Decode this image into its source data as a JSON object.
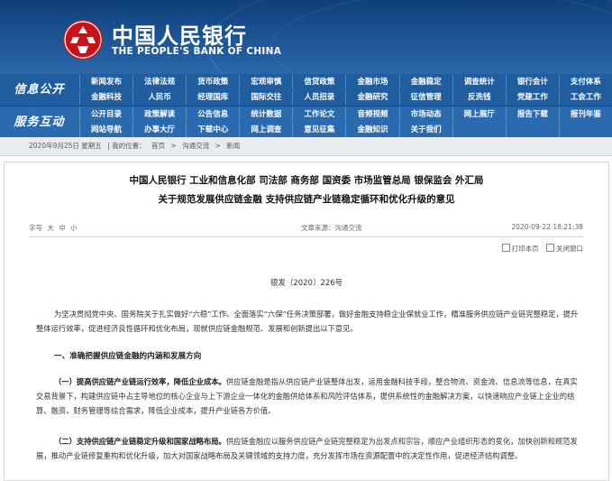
{
  "header": {
    "brand_cn": "中国人民银行",
    "brand_en": "THE PEOPLE'S BANK OF CHINA"
  },
  "nav": {
    "section1_label": "信息公开",
    "section1_items": [
      "新闻发布",
      "法律法规",
      "货币政策",
      "宏观审慎",
      "信贷政策",
      "金融市场",
      "金融稳定",
      "调查统计",
      "银行会计",
      "支付体系",
      "金融科技",
      "人民币",
      "经理国库",
      "国际交往",
      "人员招录",
      "金融研究",
      "征信管理",
      "反洗钱",
      "党建工作",
      "工会工作"
    ],
    "section2_label": "服务互动",
    "section2_items": [
      "公开目录",
      "政策解读",
      "公告信息",
      "统计数据",
      "工作论文",
      "音频视频",
      "市场动态",
      "网上展厅",
      "报告下载",
      "报刊年鉴",
      "网站导航",
      "办事大厅",
      "下载中心",
      "网上调查",
      "意见征集",
      "金融知识",
      "关于我们",
      "",
      "",
      ""
    ]
  },
  "breadcrumb": {
    "date": "2020年9月25日 星期五",
    "prefix": "| 我的位置：",
    "items": [
      "首页",
      "沟通交流",
      "新闻"
    ],
    "sep": ">"
  },
  "article": {
    "orgs": "中国人民银行  工业和信息化部  司法部  商务部  国资委  市场监管总局  银保监会  外汇局",
    "title": "关于规范发展供应链金融  支持供应链产业链稳定循环和优化升级的意见",
    "size_label": "字号",
    "size_options": [
      "大",
      "中",
      "小"
    ],
    "source": "文章来源：沟通交流",
    "date": "2020-09-22  18:21:38",
    "print_label": "打印本页",
    "close_label": "关闭窗口",
    "doc_number": "银发〔2020〕226号",
    "p1": "为坚决贯彻党中央、国务院关于扎实做好“六稳”工作、全面落实“六保”任务决策部署，做好金融支持稳企业保就业工作，精准服务供应链产业链完整稳定，提升整体运行效率，促进经济良性循环和优化布局，现就供应链金融规范、发展和创新提出以下意见。",
    "h1": "一、准确把握供应链金融的内涵和发展方向",
    "p2_lead": "（一）提高供应链产业链运行效率，降低企业成本。",
    "p2": "供应链金融是指从供应链产业链整体出发，运用金融科技手段，整合物流、资金流、信息流等信息，在真实交易背景下，构建供应链中占主导地位的核心企业与上下游企业一体化的金融供给体系和风险评估体系，提供系统性的金融解决方案，以快速响应产业链上企业的结算、融资、财务管理等综合需求，降低企业成本，提升产业链各方价值。",
    "p3_lead": "（二）支持供应链产业链稳定升级和国家战略布局。",
    "p3": "供应链金融应以服务供应链产业链完整稳定为出发点和宗旨，顺应产业组织形态的变化，加快创新和规范发展，推动产业链修复重构和优化升级，加大对国家战略布局及关键领域的支持力度，充分发挥市场在资源配置中的决定性作用，促进经济结构调整。"
  }
}
